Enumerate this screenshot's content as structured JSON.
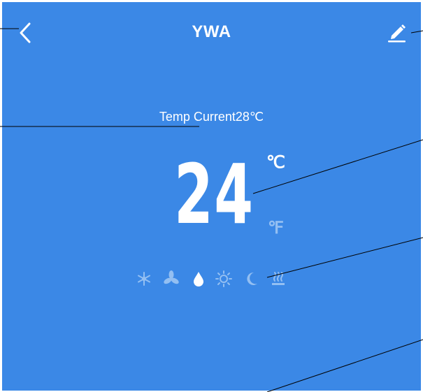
{
  "header": {
    "title": "YWA",
    "back_icon": "chevron-left-icon",
    "edit_icon": "pencil-icon"
  },
  "status": {
    "temp_current": "Temp Current28℃"
  },
  "setpoint": {
    "value": "24",
    "unit_c": "℃",
    "unit_f": "℉",
    "selected_unit": "℃"
  },
  "modes": [
    {
      "icon": "snowflake-icon",
      "active": false
    },
    {
      "icon": "fan-icon",
      "active": false
    },
    {
      "icon": "water-drop-icon",
      "active": true
    },
    {
      "icon": "sun-icon",
      "active": false
    },
    {
      "icon": "moon-icon",
      "active": false
    },
    {
      "icon": "heat-icon",
      "active": false
    }
  ],
  "colors": {
    "background": "#3b88e6",
    "foreground": "#ffffff",
    "inactive": "#93bff2",
    "annotation": "#000000"
  }
}
